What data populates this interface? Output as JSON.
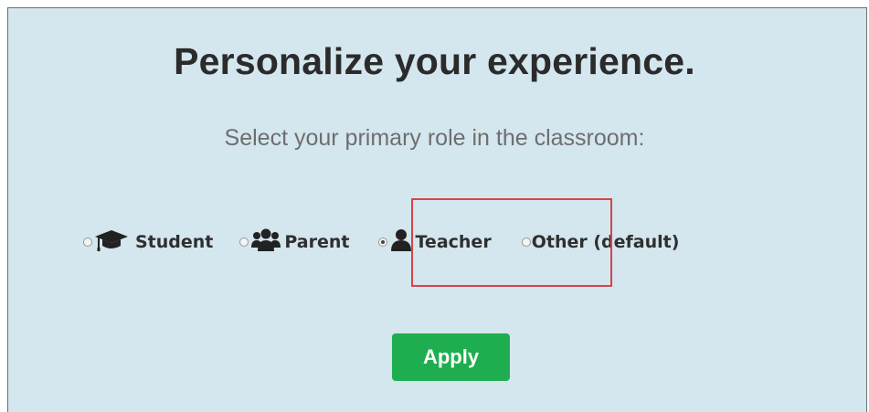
{
  "panel": {
    "title": "Personalize your experience.",
    "subtitle": "Select your primary role in the classroom:"
  },
  "roles": [
    {
      "label": "Student",
      "icon": "graduation-cap-icon",
      "selected": false
    },
    {
      "label": "Parent",
      "icon": "users-icon",
      "selected": false
    },
    {
      "label": "Teacher",
      "icon": "user-icon",
      "selected": true
    },
    {
      "label": "Other (default)",
      "icon": "",
      "selected": false
    }
  ],
  "highlight": {
    "target": "Teacher",
    "color": "#d9434a"
  },
  "apply_button": {
    "label": "Apply",
    "color": "#1fae4f"
  },
  "colors": {
    "background": "#d4e6ee",
    "title": "#2b2b2b",
    "subtitle": "#6e6e6e"
  }
}
